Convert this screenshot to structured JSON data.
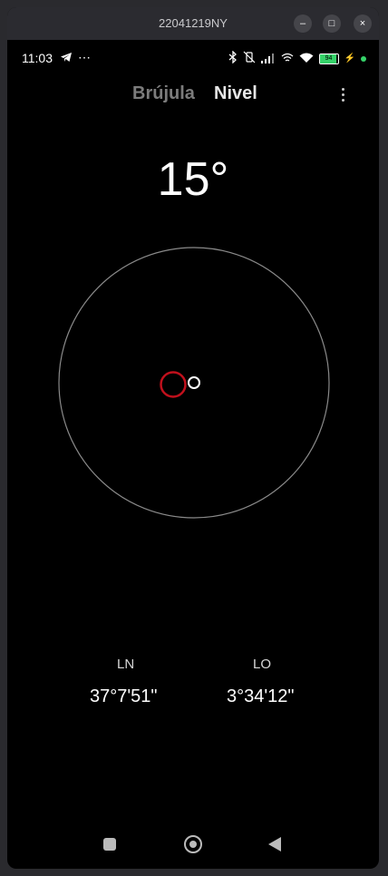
{
  "window": {
    "title": "22041219NY"
  },
  "window_controls": {
    "minimize": "–",
    "maximize": "□",
    "close": "×"
  },
  "statusbar": {
    "time": "11:03",
    "battery": "94"
  },
  "tabs": {
    "compass": "Brújula",
    "level": "Nivel"
  },
  "level": {
    "angle": "15°"
  },
  "coordinates": {
    "lat_label": "LN",
    "lat_value": "37°7'51\"",
    "lon_label": "LO",
    "lon_value": "3°34'12\""
  },
  "colors": {
    "background": "#000000",
    "target_circle": "#c0101c",
    "bubble": "#ffffff",
    "ring": "#8a8a8a"
  }
}
